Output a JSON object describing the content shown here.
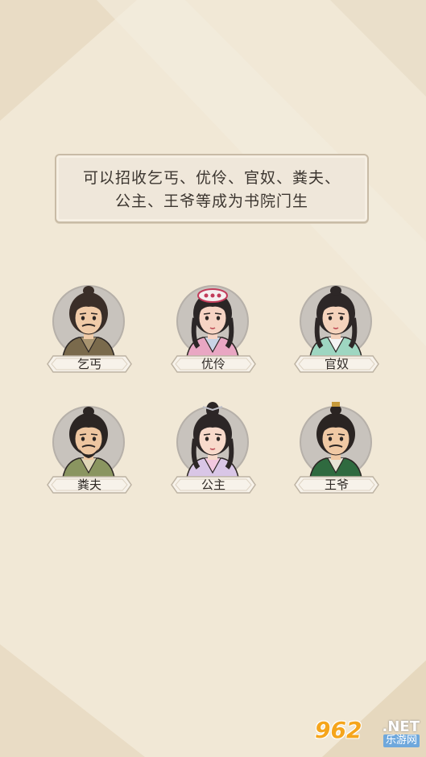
{
  "banner": {
    "line1": "可以招收乞丐、优伶、官奴、粪夫、",
    "line2": "公主、王爷等成为书院门生"
  },
  "characters": [
    {
      "label": "乞丐",
      "hair": "#3a2e28",
      "skin": "#f0cba8",
      "robe": "#7a6a4c",
      "collar": "#a89470"
    },
    {
      "label": "优伶",
      "hair": "#2b2626",
      "skin": "#f6d4c4",
      "robe": "#e9a7c3",
      "collar": "#c9d4e6"
    },
    {
      "label": "官奴",
      "hair": "#2d2727",
      "skin": "#f5d3bc",
      "robe": "#9ed6c1",
      "collar": "#f3f3f3"
    },
    {
      "label": "粪夫",
      "hair": "#2b2523",
      "skin": "#eec6a0",
      "robe": "#8a9560",
      "collar": "#dfd7b8"
    },
    {
      "label": "公主",
      "hair": "#2c2626",
      "skin": "#f8dacb",
      "robe": "#d9c6e6",
      "collar": "#f2c8e0"
    },
    {
      "label": "王爷",
      "hair": "#2a2422",
      "skin": "#f0c9a4",
      "robe": "#2f6a3f",
      "collar": "#e6e3d6"
    }
  ],
  "watermark": {
    "logo": "962",
    "net": ".NET",
    "sub": "乐游网"
  },
  "colors": {
    "background": "#f1e8d6",
    "circle": "#c8c3bd",
    "text": "#2f2a26"
  }
}
